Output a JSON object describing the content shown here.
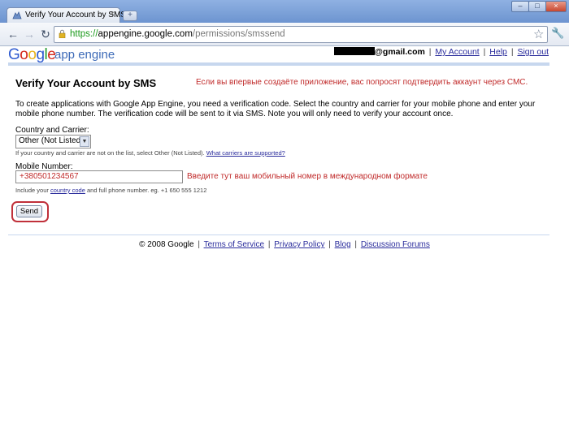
{
  "browser": {
    "tab_title": "Verify Your Account by SMS",
    "tab_close": "×",
    "newtab": "+",
    "win_min": "–",
    "win_max": "□",
    "win_close": "×",
    "back": "←",
    "forward": "→",
    "reload": "↻",
    "url_scheme": "https://",
    "url_host": "appengine.google.com",
    "url_path": "/permissions/smssend",
    "star": "☆",
    "wrench": "🔧"
  },
  "header": {
    "logo_letters": [
      "G",
      "o",
      "o",
      "g",
      "l",
      "e"
    ],
    "product": "app engine",
    "email_domain": "@gmail.com",
    "my_account": "My Account",
    "help": "Help",
    "sign_out": "Sign out",
    "sep": "|"
  },
  "main": {
    "heading": "Verify Your Account by SMS",
    "note_top": "Если вы впервые создаёте приложение, вас попросят подтвердить аккаунт через СМС.",
    "intro": "To create applications with Google App Engine, you need a verification code. Select the country and carrier for your mobile phone and enter your mobile phone number. The verification code will be sent to it via SMS. Note you will only need to verify your account once.",
    "country_label": "Country and Carrier:",
    "carrier_value": "Other (Not Listed)",
    "carrier_help": "If your country and carrier are not on the list, select Other (Not Listed). ",
    "carrier_link": "What carriers are supported?",
    "mobile_label": "Mobile Number:",
    "mobile_value": "+380501234567",
    "note_mobile": "Введите тут ваш мобильный номер в международном формате",
    "mobile_help_pre": "Include your ",
    "mobile_help_link": "country code",
    "mobile_help_post": " and full phone number. eg. +1 650 555 1212",
    "send_label": "Send"
  },
  "footer": {
    "copyright": "© 2008 Google",
    "terms": "Terms of Service",
    "privacy": "Privacy Policy",
    "blog": "Blog",
    "forums": "Discussion Forums",
    "sep": "|"
  }
}
